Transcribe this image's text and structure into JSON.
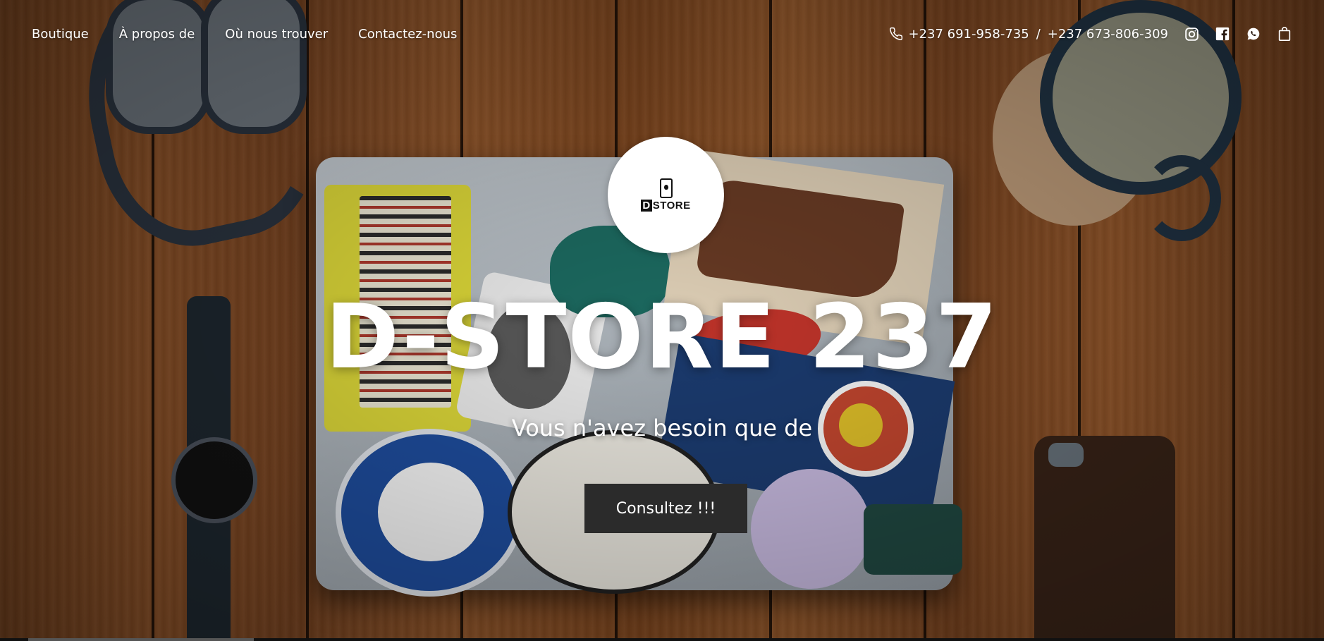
{
  "nav": {
    "links": [
      {
        "label": "Boutique"
      },
      {
        "label": "À propos de"
      },
      {
        "label": "Où nous trouver"
      },
      {
        "label": "Contactez-nous"
      }
    ],
    "phone_primary": "+237 691-958-735",
    "phone_separator": "/",
    "phone_secondary": "+237 673-806-309",
    "icons": [
      "phone-icon",
      "instagram-icon",
      "facebook-icon",
      "whatsapp-icon",
      "shopping-bag-icon"
    ]
  },
  "hero": {
    "logo_prefix": "D",
    "logo_suffix": "STORE",
    "title": "D-STORE 237",
    "subtitle": "Vous n'avez besoin que de",
    "cta_label": "Consultez !!!"
  },
  "colors": {
    "text": "#ffffff",
    "cta_background": "#2b2b2b",
    "logo_background": "#ffffff",
    "wood": "#8b5026"
  }
}
